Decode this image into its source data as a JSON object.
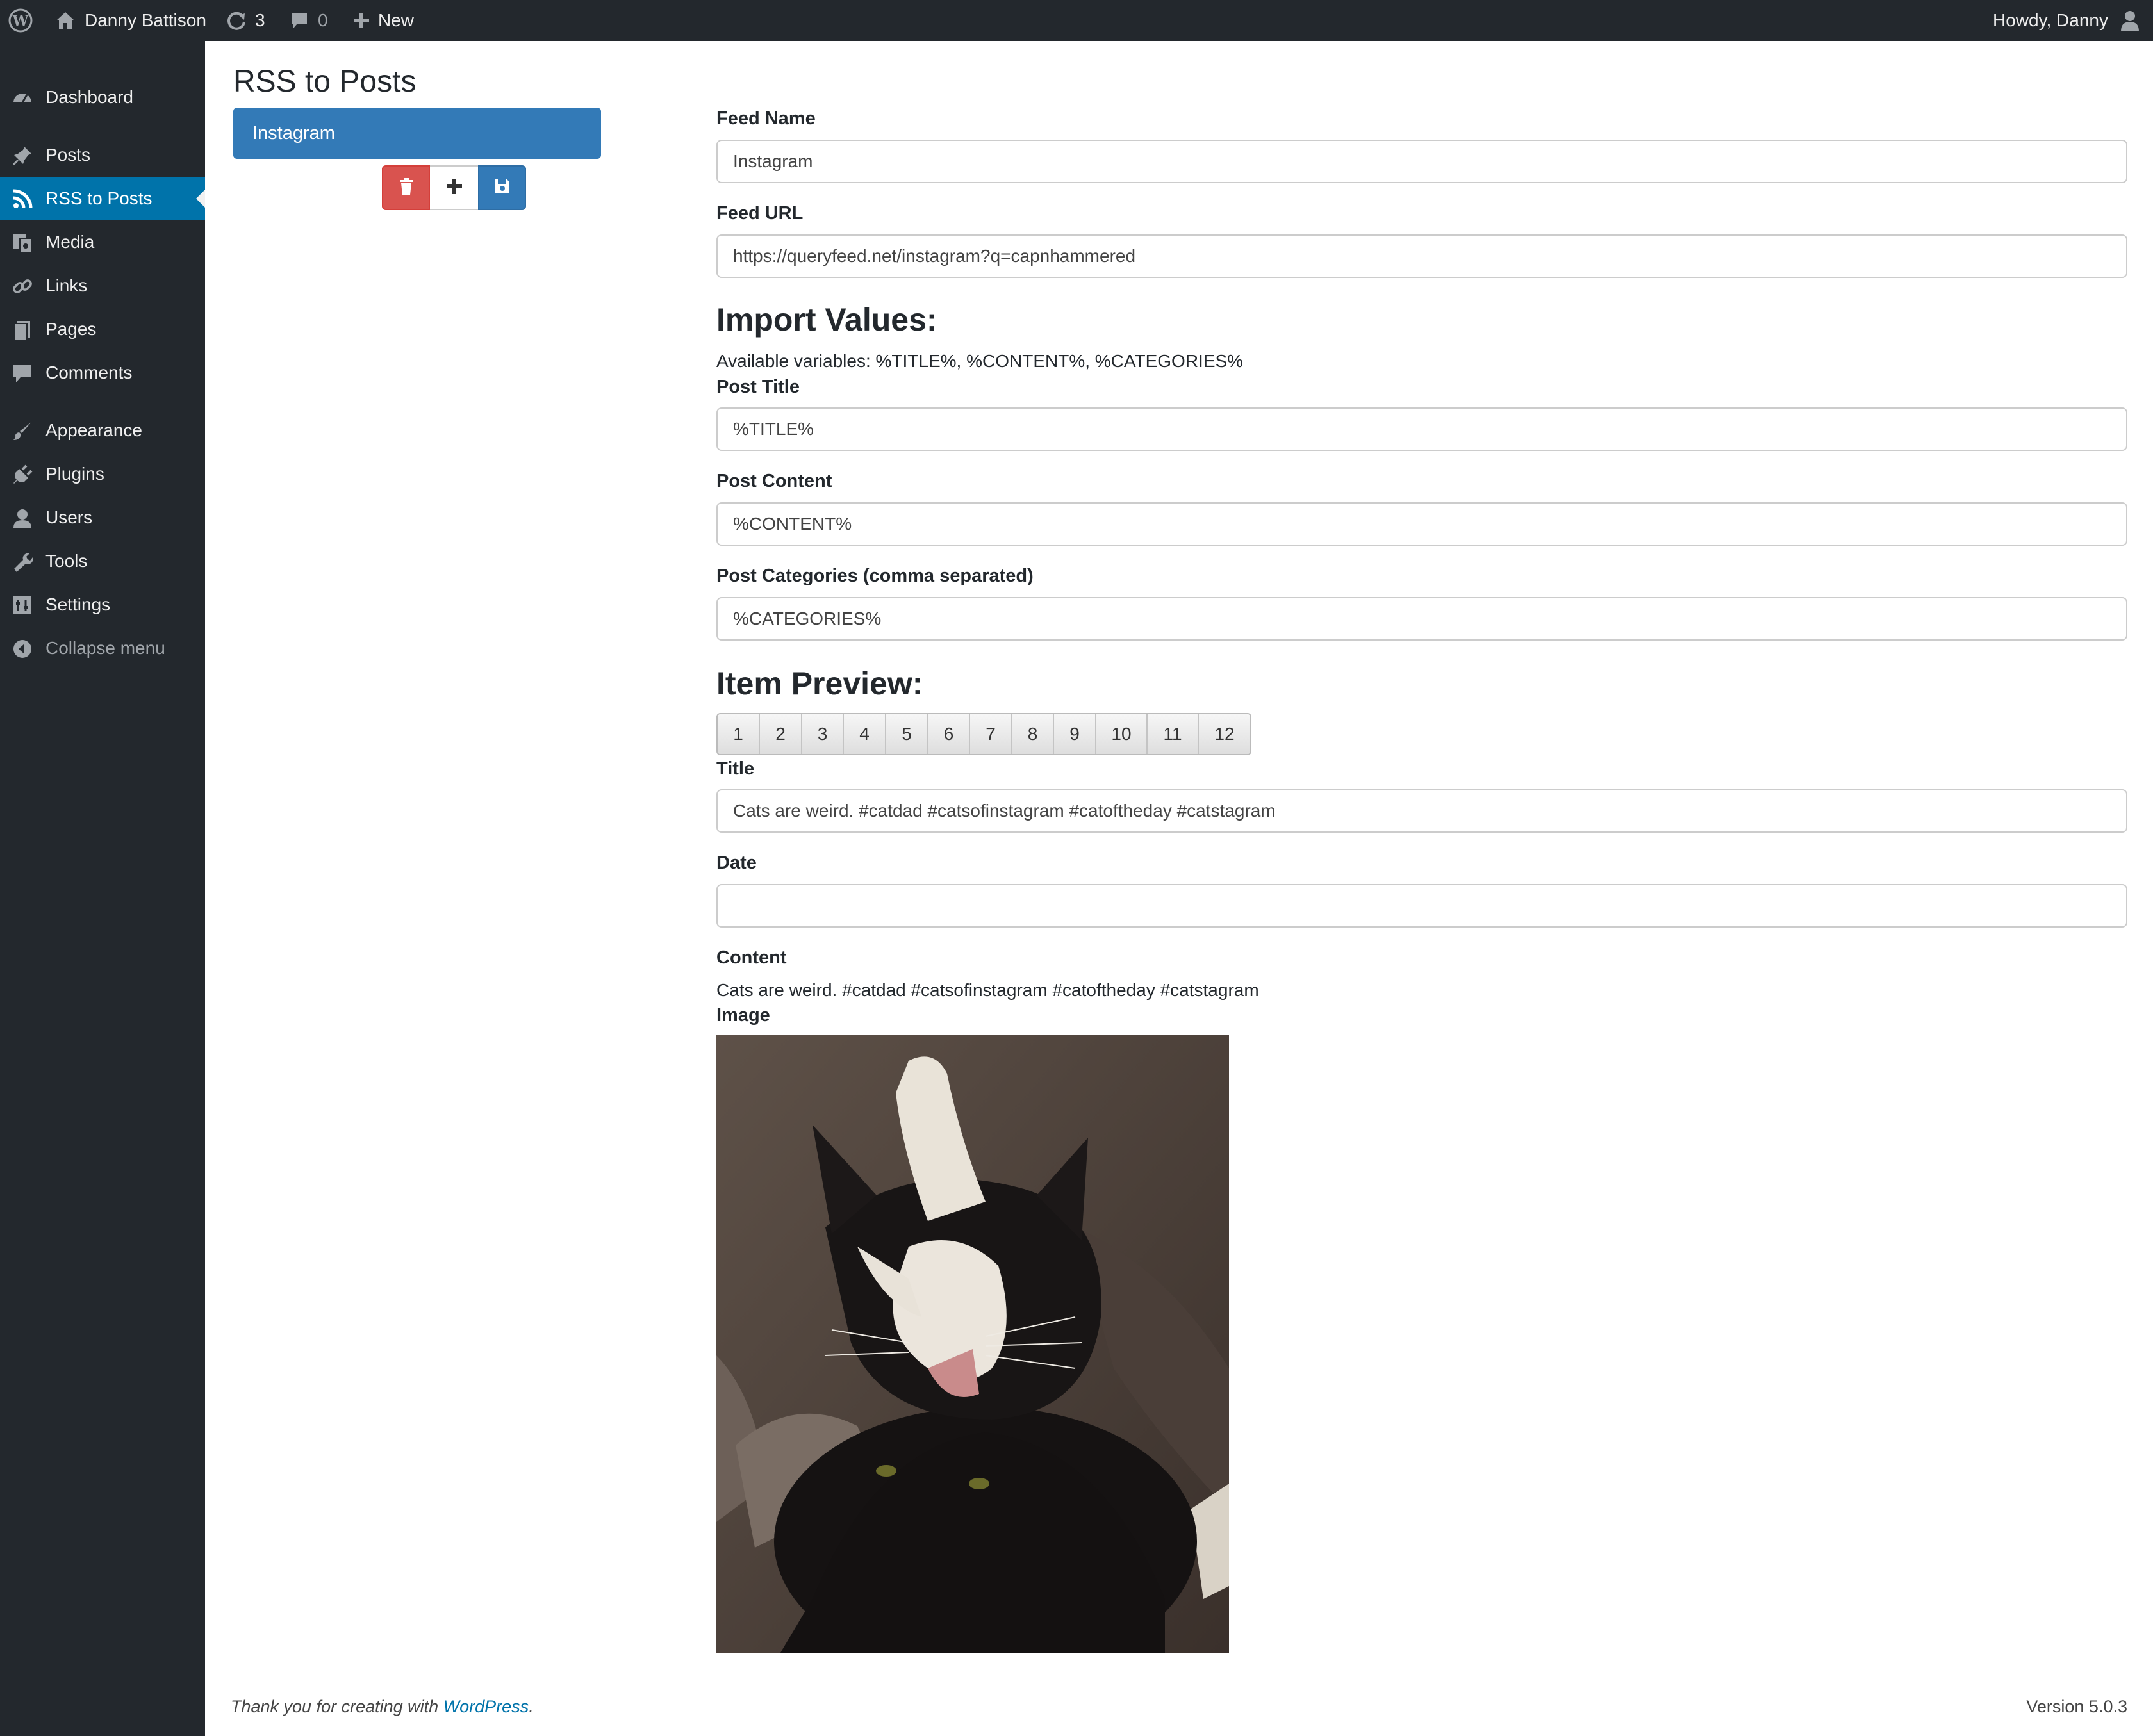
{
  "admin_bar": {
    "site_name": "Danny Battison",
    "updates_count": "3",
    "comments_count": "0",
    "new_label": "New",
    "howdy": "Howdy, Danny"
  },
  "sidebar": {
    "items": [
      {
        "label": "Dashboard",
        "icon": "dashboard-icon"
      },
      {
        "label": "Posts",
        "icon": "pin-icon"
      },
      {
        "label": "RSS to Posts",
        "icon": "rss-icon",
        "current": true
      },
      {
        "label": "Media",
        "icon": "media-icon"
      },
      {
        "label": "Links",
        "icon": "link-icon"
      },
      {
        "label": "Pages",
        "icon": "pages-icon"
      },
      {
        "label": "Comments",
        "icon": "comment-icon"
      },
      {
        "label": "Appearance",
        "icon": "brush-icon"
      },
      {
        "label": "Plugins",
        "icon": "plugin-icon"
      },
      {
        "label": "Users",
        "icon": "user-icon"
      },
      {
        "label": "Tools",
        "icon": "wrench-icon"
      },
      {
        "label": "Settings",
        "icon": "settings-icon"
      },
      {
        "label": "Collapse menu",
        "icon": "collapse-icon"
      }
    ]
  },
  "page": {
    "title": "RSS to Posts",
    "feeds": [
      "Instagram"
    ]
  },
  "form": {
    "feed_name_label": "Feed Name",
    "feed_name_value": "Instagram",
    "feed_url_label": "Feed URL",
    "feed_url_value": "https://queryfeed.net/instagram?q=capnhammered",
    "import_heading": "Import Values:",
    "available_variables": "Available variables: %TITLE%, %CONTENT%, %CATEGORIES%",
    "post_title_label": "Post Title",
    "post_title_value": "%TITLE%",
    "post_content_label": "Post Content",
    "post_content_value": "%CONTENT%",
    "post_categories_label": "Post Categories (comma separated)",
    "post_categories_value": "%CATEGORIES%"
  },
  "preview": {
    "heading": "Item Preview:",
    "pages": [
      "1",
      "2",
      "3",
      "4",
      "5",
      "6",
      "7",
      "8",
      "9",
      "10",
      "11",
      "12"
    ],
    "title_label": "Title",
    "title_value": "Cats are weird. #catdad #catsofinstagram #catoftheday #catstagram",
    "date_label": "Date",
    "date_value": "",
    "content_label": "Content",
    "content_value": "Cats are weird. #catdad #catsofinstagram #catoftheday #catstagram",
    "image_label": "Image"
  },
  "footer": {
    "thanks_prefix": "Thank you for creating with ",
    "thanks_link": "WordPress",
    "thanks_suffix": ".",
    "version": "Version 5.0.3"
  },
  "colors": {
    "admin_dark": "#23282d",
    "menu_current": "#0073aa",
    "feed_item_bg": "#337ab7",
    "delete_button": "#d9534f",
    "save_button": "#337ab7"
  }
}
